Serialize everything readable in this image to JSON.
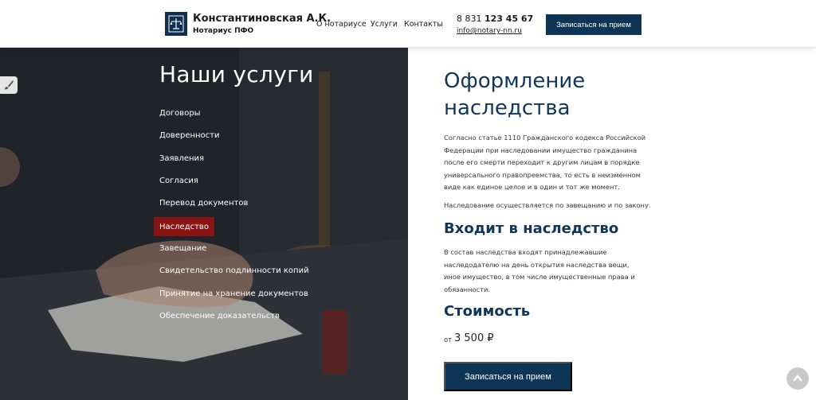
{
  "header": {
    "brand_name": "Константиновская А.К.",
    "brand_sub": "Нотариус ПФО",
    "nav": {
      "about": "О нотариусе",
      "services": "Услуги",
      "contacts": "Контакты"
    },
    "phone_prefix": "8 831",
    "phone_main": "123 45 67",
    "email": "info@notary-nn.ru",
    "cta": "Записаться на прием"
  },
  "services": {
    "title": "Наши услуги",
    "items": [
      "Договоры",
      "Доверенности",
      "Заявления",
      "Согласия",
      "Перевод документов",
      "Наследство",
      "Завещание",
      "Свидетельство подлинности копий",
      "Принятие на хранение документов",
      "Обеспечение доказательств"
    ],
    "active_index": 5
  },
  "content": {
    "title": "Оформление наследства",
    "p1": "Согласно статье 1110 Гражданского кодекса Российской Федерации при наследовании имущество гражданина после его смерти переходит к другим лицам в порядке универсального правопреемства, то есть в неизменном виде как единое целое и в один и тот же момент.",
    "p2": "Наследование осуществляется по завещанию и по закону.",
    "sub1": "Входит в наследство",
    "p3": "В состав наследства входят принадлежавшие наследодателю на день открытия наследства вещи, иное имущество, в том числе имущественные права и обязанности.",
    "sub2": "Стоимость",
    "price_prefix": "от",
    "price_value": "3 500 ₽",
    "cta": "Записаться на прием"
  },
  "colors": {
    "brand_navy": "#0f3556",
    "title_navy": "#12365a",
    "active_red": "#8a1414",
    "dark_panel": "#22252b"
  },
  "icons": [
    "logo-emblem-icon",
    "brush-icon",
    "chevron-up-icon"
  ]
}
